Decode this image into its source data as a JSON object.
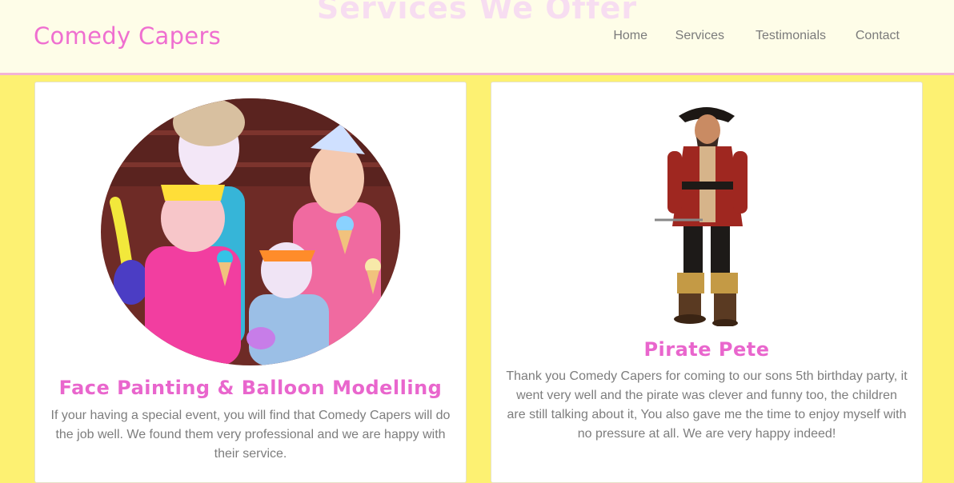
{
  "section_heading": "Services We Offer",
  "header": {
    "brand": "Comedy Capers",
    "nav": [
      "Home",
      "Services",
      "Testimonials",
      "Contact"
    ]
  },
  "cards": [
    {
      "title": "Face Painting & Balloon Modelling",
      "text": "If your having a special event, you will find that Comedy Capers will do the job well. We found them very professional and we are happy with their service.",
      "image": "face-painted-children-photo"
    },
    {
      "title": "Pirate Pete",
      "text": "Thank you Comedy Capers for coming to our sons 5th birthday party, it went very well and the pirate was clever and funny too, the children are still talking about it, You also gave me the time to enjoy myself with no pressure at all. We are very happy indeed!",
      "image": "pirate-costume-photo"
    }
  ],
  "colors": {
    "page_background": "#fdf172",
    "navbar_background": "#fefde8",
    "accent_pink": "#ef6fd0",
    "nav_text": "#7b7b7b"
  }
}
